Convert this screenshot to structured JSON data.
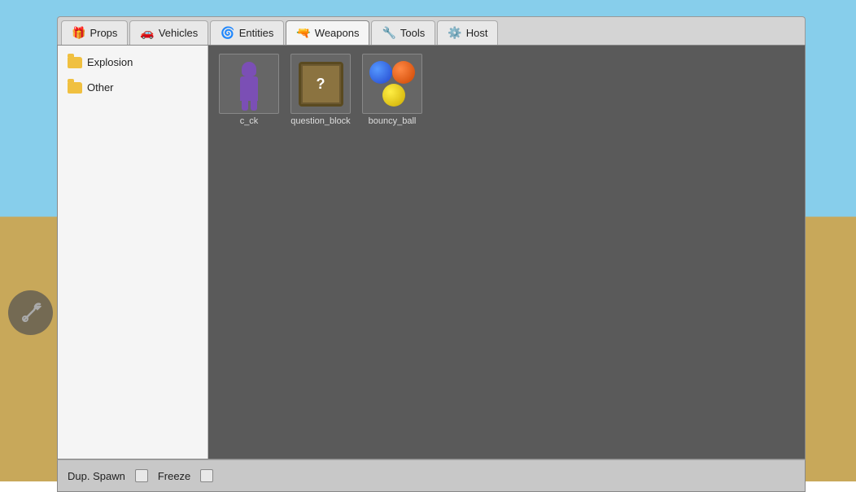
{
  "background": {
    "sky_color": "#87ceeb",
    "ground_color": "#c8a85a"
  },
  "tabs": [
    {
      "id": "props",
      "label": "Props",
      "icon": "🎁",
      "active": false
    },
    {
      "id": "vehicles",
      "label": "Vehicles",
      "icon": "🚗",
      "active": false
    },
    {
      "id": "entities",
      "label": "Entities",
      "icon": "🌀",
      "active": false
    },
    {
      "id": "weapons",
      "label": "Weapons",
      "icon": "🔫",
      "active": true
    },
    {
      "id": "tools",
      "label": "Tools",
      "icon": "🔧",
      "active": false
    },
    {
      "id": "host",
      "label": "Host",
      "icon": "⚙️",
      "active": false
    }
  ],
  "sidebar": {
    "items": [
      {
        "id": "explosion",
        "label": "Explosion"
      },
      {
        "id": "other",
        "label": "Other"
      }
    ]
  },
  "items": [
    {
      "id": "c_ck",
      "label": "c_ck",
      "type": "figure"
    },
    {
      "id": "question_block",
      "label": "question_block",
      "type": "block"
    },
    {
      "id": "bouncy_ball",
      "label": "bouncy_ball",
      "type": "balls"
    }
  ],
  "footer": {
    "dup_spawn_label": "Dup. Spawn",
    "freeze_label": "Freeze"
  }
}
